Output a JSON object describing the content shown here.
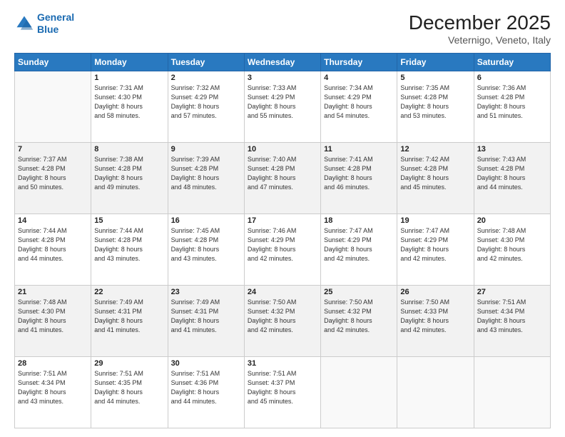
{
  "header": {
    "logo_line1": "General",
    "logo_line2": "Blue",
    "month_title": "December 2025",
    "location": "Veternigo, Veneto, Italy"
  },
  "weekdays": [
    "Sunday",
    "Monday",
    "Tuesday",
    "Wednesday",
    "Thursday",
    "Friday",
    "Saturday"
  ],
  "weeks": [
    [
      {
        "day": "",
        "info": ""
      },
      {
        "day": "1",
        "info": "Sunrise: 7:31 AM\nSunset: 4:30 PM\nDaylight: 8 hours\nand 58 minutes."
      },
      {
        "day": "2",
        "info": "Sunrise: 7:32 AM\nSunset: 4:29 PM\nDaylight: 8 hours\nand 57 minutes."
      },
      {
        "day": "3",
        "info": "Sunrise: 7:33 AM\nSunset: 4:29 PM\nDaylight: 8 hours\nand 55 minutes."
      },
      {
        "day": "4",
        "info": "Sunrise: 7:34 AM\nSunset: 4:29 PM\nDaylight: 8 hours\nand 54 minutes."
      },
      {
        "day": "5",
        "info": "Sunrise: 7:35 AM\nSunset: 4:28 PM\nDaylight: 8 hours\nand 53 minutes."
      },
      {
        "day": "6",
        "info": "Sunrise: 7:36 AM\nSunset: 4:28 PM\nDaylight: 8 hours\nand 51 minutes."
      }
    ],
    [
      {
        "day": "7",
        "info": "Sunrise: 7:37 AM\nSunset: 4:28 PM\nDaylight: 8 hours\nand 50 minutes."
      },
      {
        "day": "8",
        "info": "Sunrise: 7:38 AM\nSunset: 4:28 PM\nDaylight: 8 hours\nand 49 minutes."
      },
      {
        "day": "9",
        "info": "Sunrise: 7:39 AM\nSunset: 4:28 PM\nDaylight: 8 hours\nand 48 minutes."
      },
      {
        "day": "10",
        "info": "Sunrise: 7:40 AM\nSunset: 4:28 PM\nDaylight: 8 hours\nand 47 minutes."
      },
      {
        "day": "11",
        "info": "Sunrise: 7:41 AM\nSunset: 4:28 PM\nDaylight: 8 hours\nand 46 minutes."
      },
      {
        "day": "12",
        "info": "Sunrise: 7:42 AM\nSunset: 4:28 PM\nDaylight: 8 hours\nand 45 minutes."
      },
      {
        "day": "13",
        "info": "Sunrise: 7:43 AM\nSunset: 4:28 PM\nDaylight: 8 hours\nand 44 minutes."
      }
    ],
    [
      {
        "day": "14",
        "info": "Sunrise: 7:44 AM\nSunset: 4:28 PM\nDaylight: 8 hours\nand 44 minutes."
      },
      {
        "day": "15",
        "info": "Sunrise: 7:44 AM\nSunset: 4:28 PM\nDaylight: 8 hours\nand 43 minutes."
      },
      {
        "day": "16",
        "info": "Sunrise: 7:45 AM\nSunset: 4:28 PM\nDaylight: 8 hours\nand 43 minutes."
      },
      {
        "day": "17",
        "info": "Sunrise: 7:46 AM\nSunset: 4:29 PM\nDaylight: 8 hours\nand 42 minutes."
      },
      {
        "day": "18",
        "info": "Sunrise: 7:47 AM\nSunset: 4:29 PM\nDaylight: 8 hours\nand 42 minutes."
      },
      {
        "day": "19",
        "info": "Sunrise: 7:47 AM\nSunset: 4:29 PM\nDaylight: 8 hours\nand 42 minutes."
      },
      {
        "day": "20",
        "info": "Sunrise: 7:48 AM\nSunset: 4:30 PM\nDaylight: 8 hours\nand 42 minutes."
      }
    ],
    [
      {
        "day": "21",
        "info": "Sunrise: 7:48 AM\nSunset: 4:30 PM\nDaylight: 8 hours\nand 41 minutes."
      },
      {
        "day": "22",
        "info": "Sunrise: 7:49 AM\nSunset: 4:31 PM\nDaylight: 8 hours\nand 41 minutes."
      },
      {
        "day": "23",
        "info": "Sunrise: 7:49 AM\nSunset: 4:31 PM\nDaylight: 8 hours\nand 41 minutes."
      },
      {
        "day": "24",
        "info": "Sunrise: 7:50 AM\nSunset: 4:32 PM\nDaylight: 8 hours\nand 42 minutes."
      },
      {
        "day": "25",
        "info": "Sunrise: 7:50 AM\nSunset: 4:32 PM\nDaylight: 8 hours\nand 42 minutes."
      },
      {
        "day": "26",
        "info": "Sunrise: 7:50 AM\nSunset: 4:33 PM\nDaylight: 8 hours\nand 42 minutes."
      },
      {
        "day": "27",
        "info": "Sunrise: 7:51 AM\nSunset: 4:34 PM\nDaylight: 8 hours\nand 43 minutes."
      }
    ],
    [
      {
        "day": "28",
        "info": "Sunrise: 7:51 AM\nSunset: 4:34 PM\nDaylight: 8 hours\nand 43 minutes."
      },
      {
        "day": "29",
        "info": "Sunrise: 7:51 AM\nSunset: 4:35 PM\nDaylight: 8 hours\nand 44 minutes."
      },
      {
        "day": "30",
        "info": "Sunrise: 7:51 AM\nSunset: 4:36 PM\nDaylight: 8 hours\nand 44 minutes."
      },
      {
        "day": "31",
        "info": "Sunrise: 7:51 AM\nSunset: 4:37 PM\nDaylight: 8 hours\nand 45 minutes."
      },
      {
        "day": "",
        "info": ""
      },
      {
        "day": "",
        "info": ""
      },
      {
        "day": "",
        "info": ""
      }
    ]
  ]
}
